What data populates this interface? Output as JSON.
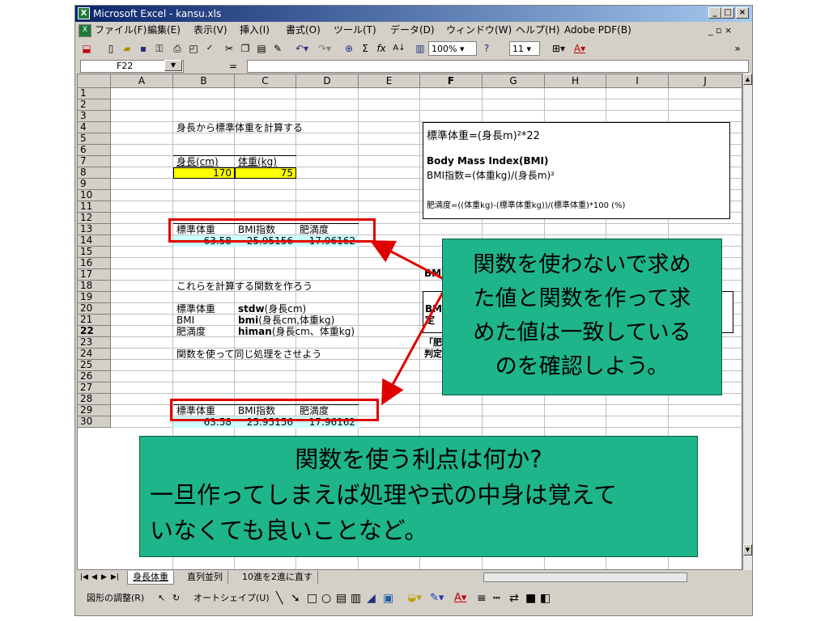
{
  "window": {
    "title": "Microsoft Excel - kansu.xls"
  },
  "menu": [
    "ファイル(F)",
    "編集(E)",
    "表示(V)",
    "挿入(I)",
    "書式(O)",
    "ツール(T)",
    "データ(D)",
    "ウィンドウ(W)",
    "ヘルプ(H)",
    "Adobe PDF(B)"
  ],
  "toolbar": {
    "zoom": "100%",
    "font_size": "11"
  },
  "formula_bar": {
    "name_box": "F22",
    "fx": "="
  },
  "columns": [
    "A",
    "B",
    "C",
    "D",
    "E",
    "F",
    "G",
    "H",
    "I",
    "J"
  ],
  "rows": [
    "1",
    "2",
    "3",
    "4",
    "5",
    "6",
    "7",
    "8",
    "9",
    "10",
    "11",
    "12",
    "13",
    "14",
    "15",
    "16",
    "17",
    "18",
    "19",
    "20",
    "21",
    "22",
    "23",
    "24",
    "25",
    "26",
    "27",
    "28",
    "29",
    "30"
  ],
  "cells": {
    "b2": "身長から標準体重を計算する",
    "b4": "身長(cm)",
    "c4": "体重(kg)",
    "b5": "170",
    "c5": "75",
    "b8": "標準体重",
    "c8": "BMI指数",
    "d8": "肥満度",
    "b9": "63.58",
    "c9": "25.95156",
    "d9": "17.96162",
    "b12": "これらを計算する関数を作ろう",
    "b13": "標準体重",
    "c13_fn": "stdw",
    "c13_args": "(身長cm)",
    "b14": "BMI",
    "c14_fn": "bmi",
    "c14_args": "(身長cm,体重kg)",
    "b15": "肥満度",
    "c15_fn": "himan",
    "c15_args": "(身長cm、体重kg)",
    "b17": "関数を使って同じ処理をさせよう",
    "b19": "標準体重",
    "c19": "BMI指数",
    "d19": "肥満度",
    "b20": "63.58",
    "c20": "25.95156",
    "d20": "17.96162",
    "f11": "BM",
    "f13": "BM",
    "f14": "定",
    "f15": "「肥",
    "f16": "判定"
  },
  "formula_box": {
    "line1": "標準体重=(身長m)²*22",
    "line2": "Body Mass Index(BMI)",
    "line3": "BMI指数=(体重kg)/(身長m)²",
    "line4": "肥満度=((体重kg)-(標準体重kg))/(標準体重)*100 (%)"
  },
  "callout1": {
    "line1": "関数を使わないで求め",
    "line2": "た値と関数を作って求",
    "line3": "めた値は一致している",
    "line4": "のを確認しよう。"
  },
  "callout2": {
    "line1": "関数を使う利点は何か?",
    "line2": "一旦作ってしまえば処理や式の中身は覚えて",
    "line3": "いなくても良いことなど。"
  },
  "sheet_tabs": [
    "身長体重",
    "直列並列",
    "10進を2進に直す"
  ],
  "drawing_toolbar": {
    "draw": "図形の調整(R)",
    "autoshape": "オートシェイプ(U)"
  },
  "colors": {
    "callout": "#1eb58a",
    "highlight_yellow": "#ffff00",
    "highlight_cyan": "#ccffff",
    "red_frame": "#e00000"
  }
}
